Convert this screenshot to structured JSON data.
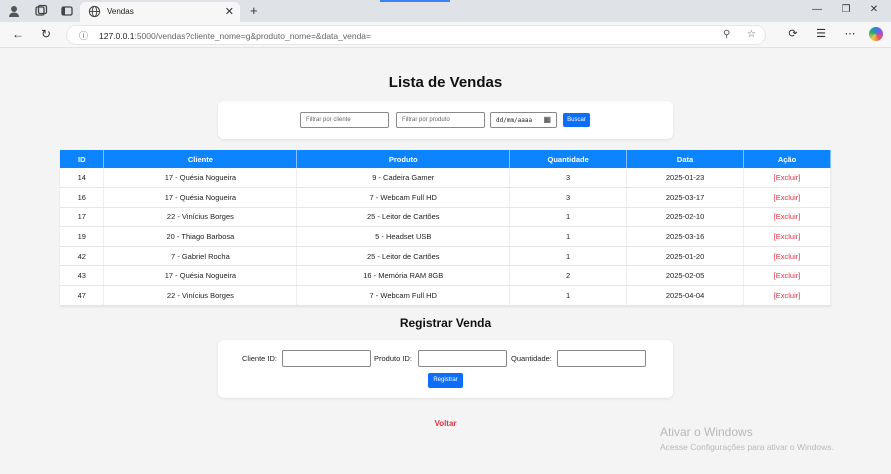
{
  "browser": {
    "tab_title": "Vendas",
    "url_host": "127.0.0.1",
    "url_rest": ":5000/vendas?cliente_nome=g&produto_nome=&data_venda="
  },
  "page": {
    "title": "Lista de Vendas",
    "filters": {
      "cliente_placeholder": "Filtrar por cliente",
      "produto_placeholder": "Filtrar por produto",
      "date_placeholder": "dd/mm/aaaa",
      "search_label": "Buscar"
    },
    "table": {
      "headers": [
        "ID",
        "Cliente",
        "Produto",
        "Quantidade",
        "Data",
        "Ação"
      ],
      "rows": [
        {
          "id": "14",
          "cliente": "17 - Quésia Nogueira",
          "produto": "9 - Cadeira Gamer",
          "quantidade": "3",
          "data": "2025-01-23",
          "acao": "[Excluir]"
        },
        {
          "id": "16",
          "cliente": "17 - Quésia Nogueira",
          "produto": "7 - Webcam Full HD",
          "quantidade": "3",
          "data": "2025-03-17",
          "acao": "[Excluir]"
        },
        {
          "id": "17",
          "cliente": "22 - Vinícius Borges",
          "produto": "25 - Leitor de Cartões",
          "quantidade": "1",
          "data": "2025-02-10",
          "acao": "[Excluir]"
        },
        {
          "id": "19",
          "cliente": "20 - Thiago Barbosa",
          "produto": "5 - Headset USB",
          "quantidade": "1",
          "data": "2025-03-16",
          "acao": "[Excluir]"
        },
        {
          "id": "42",
          "cliente": "7 - Gabriel Rocha",
          "produto": "25 - Leitor de Cartões",
          "quantidade": "1",
          "data": "2025-01-20",
          "acao": "[Excluir]"
        },
        {
          "id": "43",
          "cliente": "17 - Quésia Nogueira",
          "produto": "16 - Memória RAM 8GB",
          "quantidade": "2",
          "data": "2025-02-05",
          "acao": "[Excluir]"
        },
        {
          "id": "47",
          "cliente": "22 - Vinícius Borges",
          "produto": "7 - Webcam Full HD",
          "quantidade": "1",
          "data": "2025-04-04",
          "acao": "[Excluir]"
        }
      ]
    },
    "register": {
      "title": "Registrar Venda",
      "cliente_label": "Cliente ID:",
      "produto_label": "Produto ID:",
      "quantidade_label": "Quantidade:",
      "button_label": "Registrar"
    },
    "back_link": "Voltar"
  },
  "watermark": {
    "line1": "Ativar o Windows",
    "line2": "Acesse Configurações para ativar o Windows."
  },
  "colors": {
    "primary": "#0d84ff",
    "danger": "#dc3545"
  }
}
